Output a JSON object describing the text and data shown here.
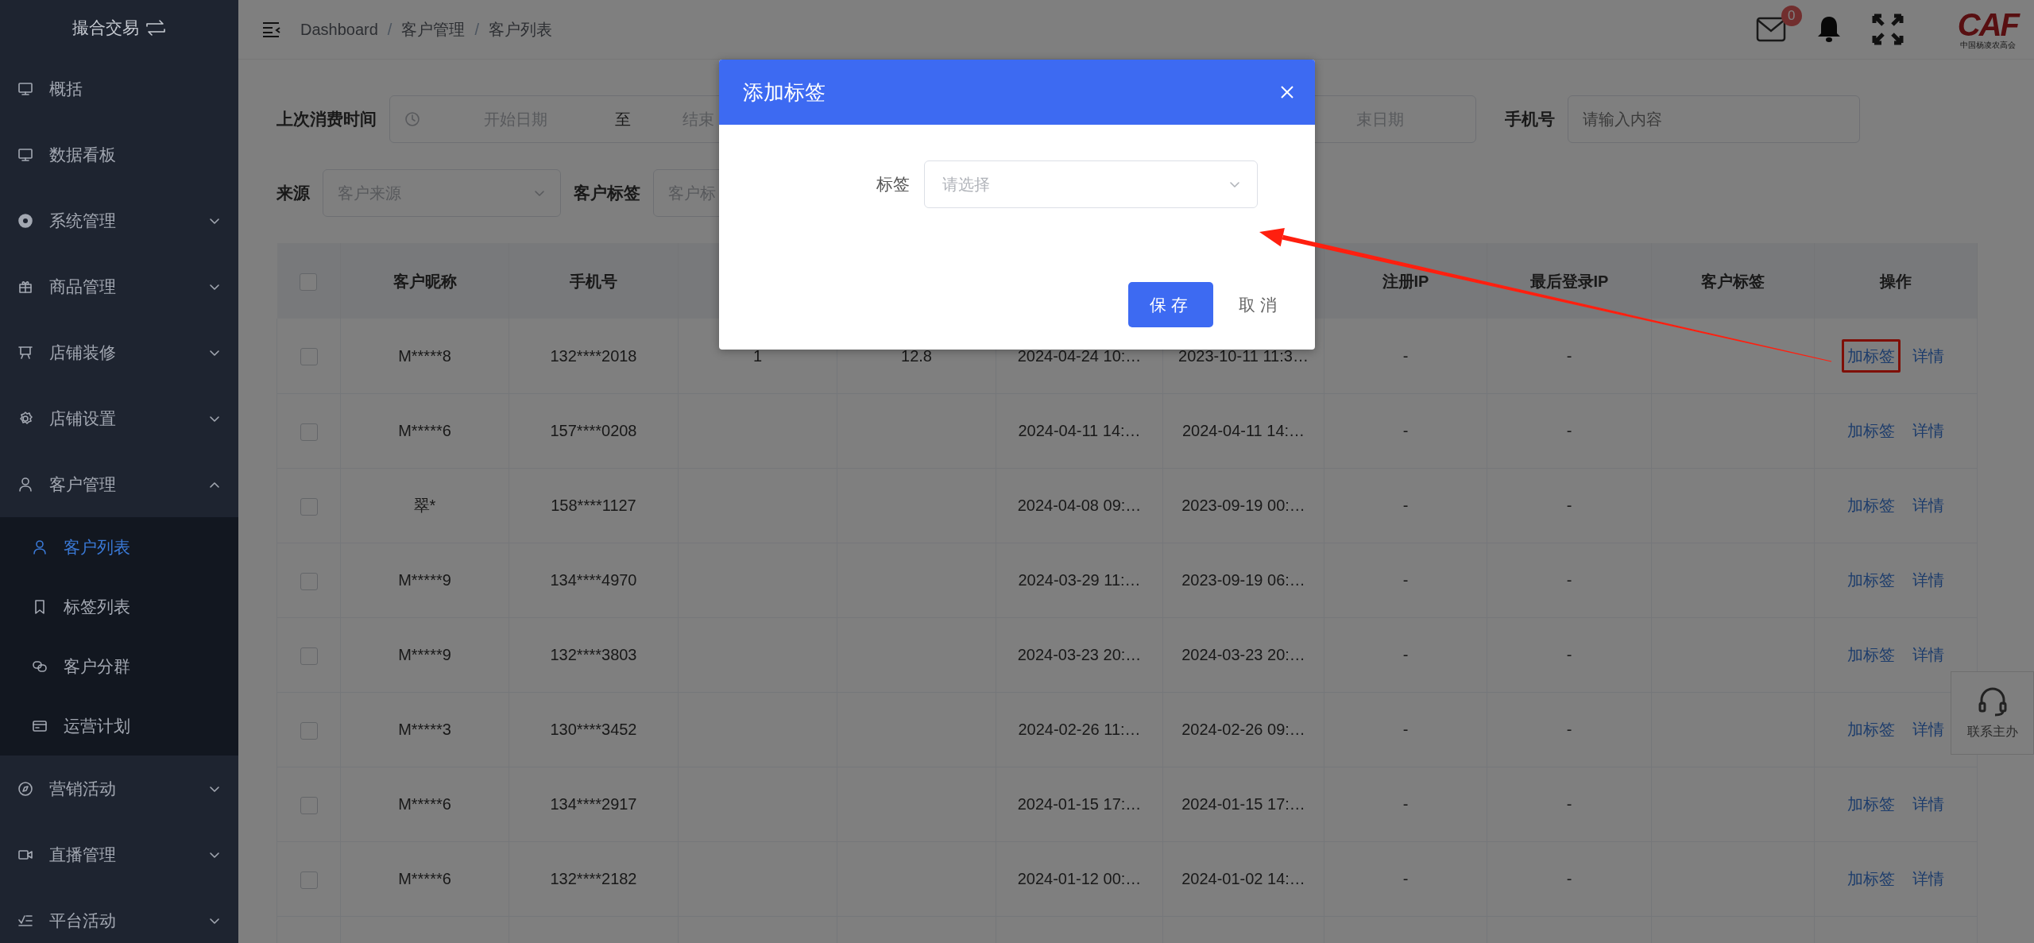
{
  "sidebar": {
    "title": "撮合交易",
    "items": [
      {
        "kind": "link",
        "label": "概括"
      },
      {
        "kind": "link",
        "label": "数据看板"
      },
      {
        "kind": "group",
        "label": "系统管理",
        "expanded": false
      },
      {
        "kind": "group",
        "label": "商品管理",
        "expanded": false
      },
      {
        "kind": "group",
        "label": "店铺装修",
        "expanded": false
      },
      {
        "kind": "group",
        "label": "店铺设置",
        "expanded": false
      },
      {
        "kind": "group",
        "label": "客户管理",
        "expanded": true,
        "children": [
          {
            "label": "客户列表",
            "selected": true
          },
          {
            "label": "标签列表",
            "selected": false
          },
          {
            "label": "客户分群",
            "selected": false
          },
          {
            "label": "运营计划",
            "selected": false
          }
        ]
      },
      {
        "kind": "group",
        "label": "营销活动",
        "expanded": false
      },
      {
        "kind": "group",
        "label": "直播管理",
        "expanded": false
      },
      {
        "kind": "group",
        "label": "平台活动",
        "expanded": false
      }
    ]
  },
  "header": {
    "breadcrumb": [
      "Dashboard",
      "客户管理",
      "客户列表"
    ],
    "breadcrumb_separator": "/",
    "mail_badge": "0",
    "logo": {
      "text": "CAF",
      "subtitle": "中国杨凌农高会"
    }
  },
  "filters": [
    [
      {
        "kind": "date_range",
        "label": "上次消费时间",
        "start_placeholder": "开始日期",
        "separator": "至",
        "end_placeholder": "结束"
      },
      {
        "kind": "date_end",
        "placeholder": "束日期"
      },
      {
        "kind": "input",
        "label": "手机号",
        "placeholder": "请输入内容"
      }
    ],
    [
      {
        "kind": "select",
        "label": "来源",
        "placeholder": "客户来源"
      },
      {
        "kind": "select",
        "label": "客户标签",
        "placeholder": "客户标"
      }
    ]
  ],
  "table": {
    "select_all_checked": false,
    "columns": [
      {
        "label": "客户昵称"
      },
      {
        "label": "手机号"
      },
      {},
      {},
      {},
      {},
      {
        "label": "注册IP"
      },
      {
        "label": "最后登录IP"
      },
      {
        "label": "客户标签"
      },
      {
        "label": "操作"
      }
    ],
    "rows": [
      {
        "checked": false,
        "cells": [
          "M*****8",
          "132****2018",
          "1",
          "12.8",
          "2024-04-24 10:…",
          "2023-10-11 11:3…",
          "-",
          "-",
          ""
        ],
        "actions": [
          {
            "label": "加标签",
            "highlighted": true
          },
          {
            "label": "详情",
            "highlighted": false
          }
        ]
      },
      {
        "checked": false,
        "cells": [
          "M*****6",
          "157****0208",
          "",
          "",
          "2024-04-11 14:…",
          "2024-04-11 14:…",
          "-",
          "-",
          ""
        ],
        "actions": [
          {
            "label": "加标签",
            "highlighted": false
          },
          {
            "label": "详情",
            "highlighted": false
          }
        ]
      },
      {
        "checked": false,
        "cells": [
          "翠*",
          "158****1127",
          "",
          "",
          "2024-04-08 09:…",
          "2023-09-19 00:…",
          "-",
          "-",
          ""
        ],
        "actions": [
          {
            "label": "加标签",
            "highlighted": false
          },
          {
            "label": "详情",
            "highlighted": false
          }
        ]
      },
      {
        "checked": false,
        "cells": [
          "M*****9",
          "134****4970",
          "",
          "",
          "2024-03-29 11:…",
          "2023-09-19 06:…",
          "-",
          "-",
          ""
        ],
        "actions": [
          {
            "label": "加标签",
            "highlighted": false
          },
          {
            "label": "详情",
            "highlighted": false
          }
        ]
      },
      {
        "checked": false,
        "cells": [
          "M*****9",
          "132****3803",
          "",
          "",
          "2024-03-23 20:…",
          "2024-03-23 20:…",
          "-",
          "-",
          ""
        ],
        "actions": [
          {
            "label": "加标签",
            "highlighted": false
          },
          {
            "label": "详情",
            "highlighted": false
          }
        ]
      },
      {
        "checked": false,
        "cells": [
          "M*****3",
          "130****3452",
          "",
          "",
          "2024-02-26 11:…",
          "2024-02-26 09:…",
          "-",
          "-",
          ""
        ],
        "actions": [
          {
            "label": "加标签",
            "highlighted": false
          },
          {
            "label": "详情",
            "highlighted": false
          }
        ]
      },
      {
        "checked": false,
        "cells": [
          "M*****6",
          "134****2917",
          "",
          "",
          "2024-01-15 17:…",
          "2024-01-15 17:…",
          "-",
          "-",
          ""
        ],
        "actions": [
          {
            "label": "加标签",
            "highlighted": false
          },
          {
            "label": "详情",
            "highlighted": false
          }
        ]
      },
      {
        "checked": false,
        "cells": [
          "M*****6",
          "132****2182",
          "",
          "",
          "2024-01-12 00:…",
          "2024-01-02 14:…",
          "-",
          "-",
          ""
        ],
        "actions": [
          {
            "label": "加标签",
            "highlighted": false
          },
          {
            "label": "详情",
            "highlighted": false
          }
        ]
      }
    ]
  },
  "help_widget": {
    "label": "联系主办"
  },
  "modal": {
    "title": "添加标签",
    "field": {
      "label": "标签",
      "placeholder": "请选择"
    },
    "buttons": [
      {
        "kind": "primary",
        "label": "保存"
      },
      {
        "kind": "text",
        "label": "取消"
      }
    ]
  }
}
